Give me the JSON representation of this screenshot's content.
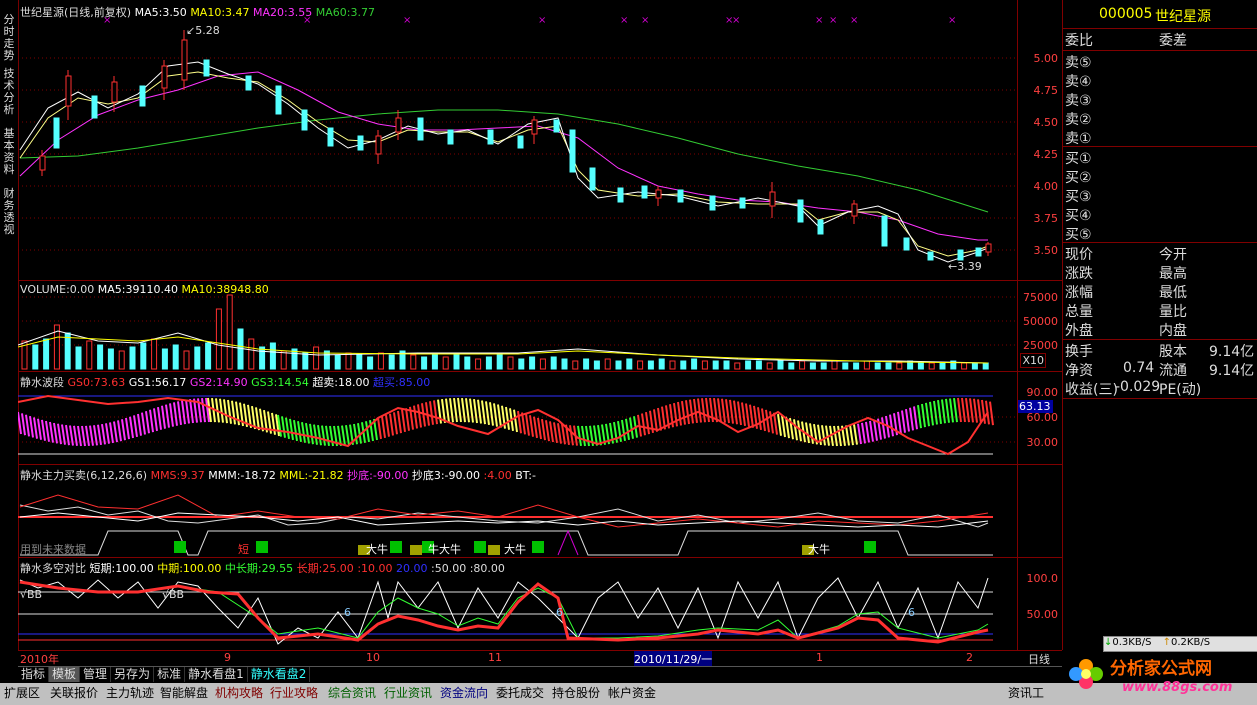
{
  "sidebar_tabs": [
    "分时走势",
    "技术分析",
    "基本资料",
    "财务透视"
  ],
  "main_header": {
    "title": "世纪星源(日线,前复权)",
    "ma5": "MA5:3.50",
    "ma10": "MA10:3.47",
    "ma20": "MA20:3.55",
    "ma60": "MA60:3.77"
  },
  "main_scale": [
    "5.00",
    "4.75",
    "4.50",
    "4.25",
    "4.00",
    "3.75",
    "3.50"
  ],
  "annotations": {
    "high": "5.28",
    "low": "3.39"
  },
  "volume_header": {
    "vol": "VOLUME:0.00",
    "ma5": "MA5:39110.40",
    "ma10": "MA10:38948.80"
  },
  "volume_scale": [
    "75000",
    "50000",
    "25000",
    "X10"
  ],
  "ind1_header": {
    "name": "静水波段",
    "gs0": "GS0:73.63",
    "gs1": "GS1:56.17",
    "gs2": "GS2:14.90",
    "gs3": "GS3:14.54",
    "chaomai": "超卖:18.00",
    "extra": "超买:85.00"
  },
  "ind1_scale": [
    "90.00",
    "60.00",
    "30.00"
  ],
  "ind1_value": "63.13",
  "ind2_header": {
    "name": "静水主力买卖(6,12,26,6)",
    "mms": "MMS:9.37",
    "mmm": "MMM:-18.72",
    "mml": "MML:-21.82",
    "chaodi": "抄底:-90.00",
    "chaodi3": "抄底3:-90.00",
    "n4": ":4.00",
    "bt": "BT:-"
  },
  "ind2_markers": [
    "短",
    "大牛",
    "牛大牛",
    "大牛",
    "大牛"
  ],
  "ind2_note": "用到未来数据",
  "ind3_header": {
    "name": "静水多空对比",
    "short": "短期:100.00",
    "mid": "中期:100.00",
    "midlong": "中长期:29.55",
    "long": "长期:25.00",
    "p10": ":10.00",
    "p20": "20.00",
    "p50": ":50.00",
    "p80": ":80.00"
  },
  "ind3_scale": [
    "100.0",
    "50.00"
  ],
  "ind3_labels": [
    "BB",
    "BB",
    "6",
    "6",
    "6"
  ],
  "xaxis": {
    "labels": [
      "2010年",
      "9",
      "10",
      "11",
      "2010/11/29/一",
      "1",
      "2"
    ],
    "period": "日线"
  },
  "quote": {
    "code": "000005",
    "name": "世纪星源",
    "header_left": "委比",
    "header_right": "委差",
    "sell": [
      "卖⑤",
      "卖④",
      "卖③",
      "卖②",
      "卖①"
    ],
    "buy": [
      "买①",
      "买②",
      "买③",
      "买④",
      "买⑤"
    ],
    "rows_left": [
      "现价",
      "涨跌",
      "涨幅",
      "总量",
      "外盘"
    ],
    "rows_right": [
      "今开",
      "最高",
      "最低",
      "量比",
      "内盘"
    ],
    "turnover": "换手",
    "capital": "股本",
    "capital_value": "9.14亿",
    "netasset": "净资",
    "netasset_value": "0.74",
    "float": "流通",
    "float_value": "9.14亿",
    "earn": "收益(三)",
    "earn_value": "-0.029",
    "pe": "PE(动)",
    "net_down": "0.3KB/S",
    "net_up": "0.2KB/S"
  },
  "bottom_tabs": [
    "指标",
    "模板",
    "管理",
    "另存为",
    "标准",
    "静水看盘1",
    "静水看盘2"
  ],
  "function_bar": [
    "扩展区",
    "关联报价",
    "主力轨迹",
    "智能解盘",
    "机构攻略",
    "行业攻略",
    "综合资讯",
    "行业资讯",
    "资金流向",
    "委托成交",
    "持仓股份",
    "帐户资金"
  ],
  "status_right": "资讯工",
  "logo": {
    "text": "分析家公式网",
    "url": "www.88gs.com"
  }
}
